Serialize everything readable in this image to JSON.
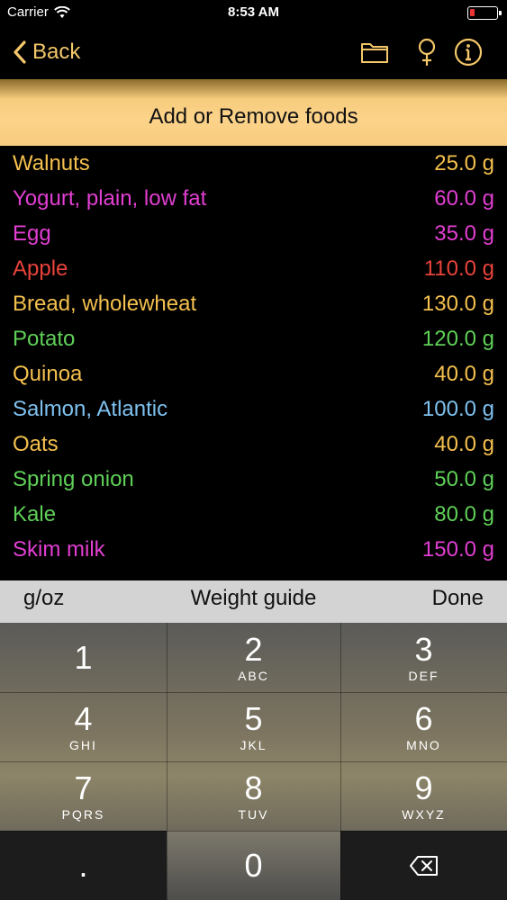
{
  "status_bar": {
    "carrier": "Carrier",
    "time": "8:53 AM",
    "icons": [
      "wifi-icon",
      "battery-icon"
    ]
  },
  "nav": {
    "back_label": "Back",
    "icons": [
      "folder-icon",
      "female-symbol-icon",
      "info-icon"
    ],
    "accent_color": "#f4c86a"
  },
  "banner": {
    "title": "Add or Remove foods",
    "color": "#fcd38a"
  },
  "foods": [
    {
      "name": "Walnuts",
      "weight": "25.0 g",
      "color": "#f4c04e"
    },
    {
      "name": "Yogurt, plain, low fat",
      "weight": "60.0 g",
      "color": "#e23fd2"
    },
    {
      "name": "Egg",
      "weight": "35.0 g",
      "color": "#e23fd2"
    },
    {
      "name": "Apple",
      "weight": "110.0 g",
      "color": "#e8433a"
    },
    {
      "name": "Bread, wholewheat",
      "weight": "130.0 g",
      "color": "#f4c04e"
    },
    {
      "name": "Potato",
      "weight": "120.0 g",
      "color": "#5fd057"
    },
    {
      "name": "Quinoa",
      "weight": "40.0 g",
      "color": "#f4c04e"
    },
    {
      "name": "Salmon, Atlantic",
      "weight": "100.0 g",
      "color": "#7ec1ef"
    },
    {
      "name": "Oats",
      "weight": "40.0 g",
      "color": "#f4c04e"
    },
    {
      "name": "Spring onion",
      "weight": "50.0 g",
      "color": "#5fd057"
    },
    {
      "name": "Kale",
      "weight": "80.0 g",
      "color": "#5fd057"
    },
    {
      "name": "Skim milk",
      "weight": "150.0 g",
      "color": "#e23fd2"
    }
  ],
  "toolbar": {
    "unit_label": "g/oz",
    "guide_label": "Weight guide",
    "done_label": "Done"
  },
  "keypad": {
    "keys": [
      {
        "digit": "1",
        "letters": ""
      },
      {
        "digit": "2",
        "letters": "ABC"
      },
      {
        "digit": "3",
        "letters": "DEF"
      },
      {
        "digit": "4",
        "letters": "GHI"
      },
      {
        "digit": "5",
        "letters": "JKL"
      },
      {
        "digit": "6",
        "letters": "MNO"
      },
      {
        "digit": "7",
        "letters": "PQRS"
      },
      {
        "digit": "8",
        "letters": "TUV"
      },
      {
        "digit": "9",
        "letters": "WXYZ"
      }
    ],
    "decimal": ".",
    "zero": "0",
    "delete_icon": "backspace-icon"
  }
}
